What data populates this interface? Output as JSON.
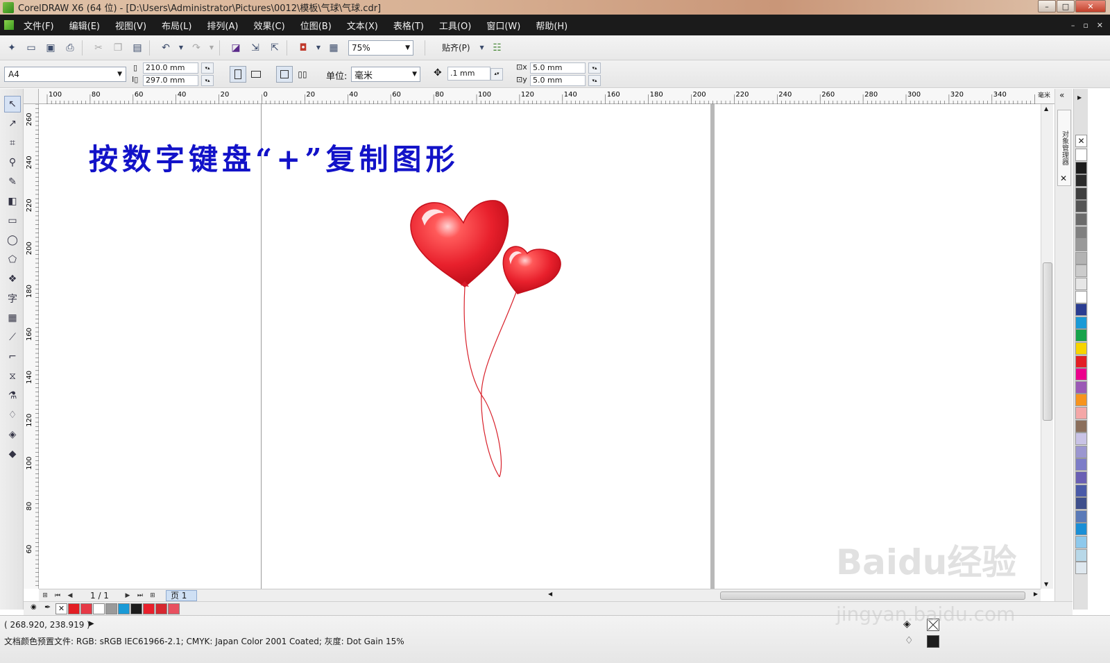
{
  "window": {
    "title": "CorelDRAW X6 (64 位) - [D:\\Users\\Administrator\\Pictures\\0012\\模板\\气球\\气球.cdr]",
    "min": "–",
    "max": "□",
    "close": "✕"
  },
  "menu": {
    "items": [
      "文件(F)",
      "编辑(E)",
      "视图(V)",
      "布局(L)",
      "排列(A)",
      "效果(C)",
      "位图(B)",
      "文本(X)",
      "表格(T)",
      "工具(O)",
      "窗口(W)",
      "帮助(H)"
    ]
  },
  "toolbar": {
    "zoom": "75%",
    "snap": "贴齐(P)"
  },
  "propertybar": {
    "paper": "A4",
    "width": "210.0 mm",
    "height": "297.0 mm",
    "unit_label": "单位:",
    "unit": "毫米",
    "nudge": ".1 mm",
    "dup_x": "5.0 mm",
    "dup_y": "5.0 mm"
  },
  "ruler": {
    "top_labels": [
      "100",
      "80",
      "60",
      "40",
      "20",
      "0",
      "20",
      "40",
      "60",
      "80",
      "100",
      "120",
      "140",
      "160",
      "180",
      "200",
      "220",
      "240",
      "260",
      "280",
      "300",
      "320",
      "340"
    ],
    "top_unit": "毫米",
    "left_labels": [
      "260",
      "240",
      "220",
      "200",
      "180",
      "160",
      "140",
      "120",
      "100",
      "80",
      "60"
    ]
  },
  "canvas": {
    "instruction": "按数字键盘“+”复制图形"
  },
  "docker": {
    "tab": "对象管理器"
  },
  "pagenav": {
    "count": "1 / 1",
    "tab": "页 1"
  },
  "status": {
    "coords": "( 268.920, 238.919 )",
    "profile": "文档颜色预置文件: RGB: sRGB IEC61966-2.1; CMYK: Japan Color 2001 Coated; 灰度: Dot Gain 15%"
  },
  "watermark": {
    "text": "Baidu经验",
    "sub": "jingyan.baidu.com"
  },
  "colors": {
    "balloon": "#e8202c",
    "instruction": "#1212c8",
    "palette": [
      "#ffffff",
      "#1c1c1c",
      "#2b2b2b",
      "#3f3f3f",
      "#555555",
      "#6b6b6b",
      "#808080",
      "#999999",
      "#b3b3b3",
      "#cccccc",
      "#e6e6e6",
      "#ffffff",
      "#2b3d91",
      "#1a9ad6",
      "#16a34a",
      "#f7d400",
      "#e31e24",
      "#ec008c",
      "#9b59b6",
      "#f7941d",
      "#f4a7a7",
      "#8b6f5c",
      "#c9c3e6",
      "#9b96d0",
      "#7c7cc8",
      "#6a5fb4",
      "#4a5aa8",
      "#3e4f8c",
      "#5a7ab8",
      "#1a8fd6",
      "#8ec9ec",
      "#b8d8e8",
      "#dfe8ef"
    ],
    "doc_palette": [
      "#e31e24",
      "#e63946",
      "#ffffff",
      "#9a9a9a",
      "#1a9ad6",
      "#1c1c1c",
      "#e8202c",
      "#d62830",
      "#e85060"
    ]
  }
}
